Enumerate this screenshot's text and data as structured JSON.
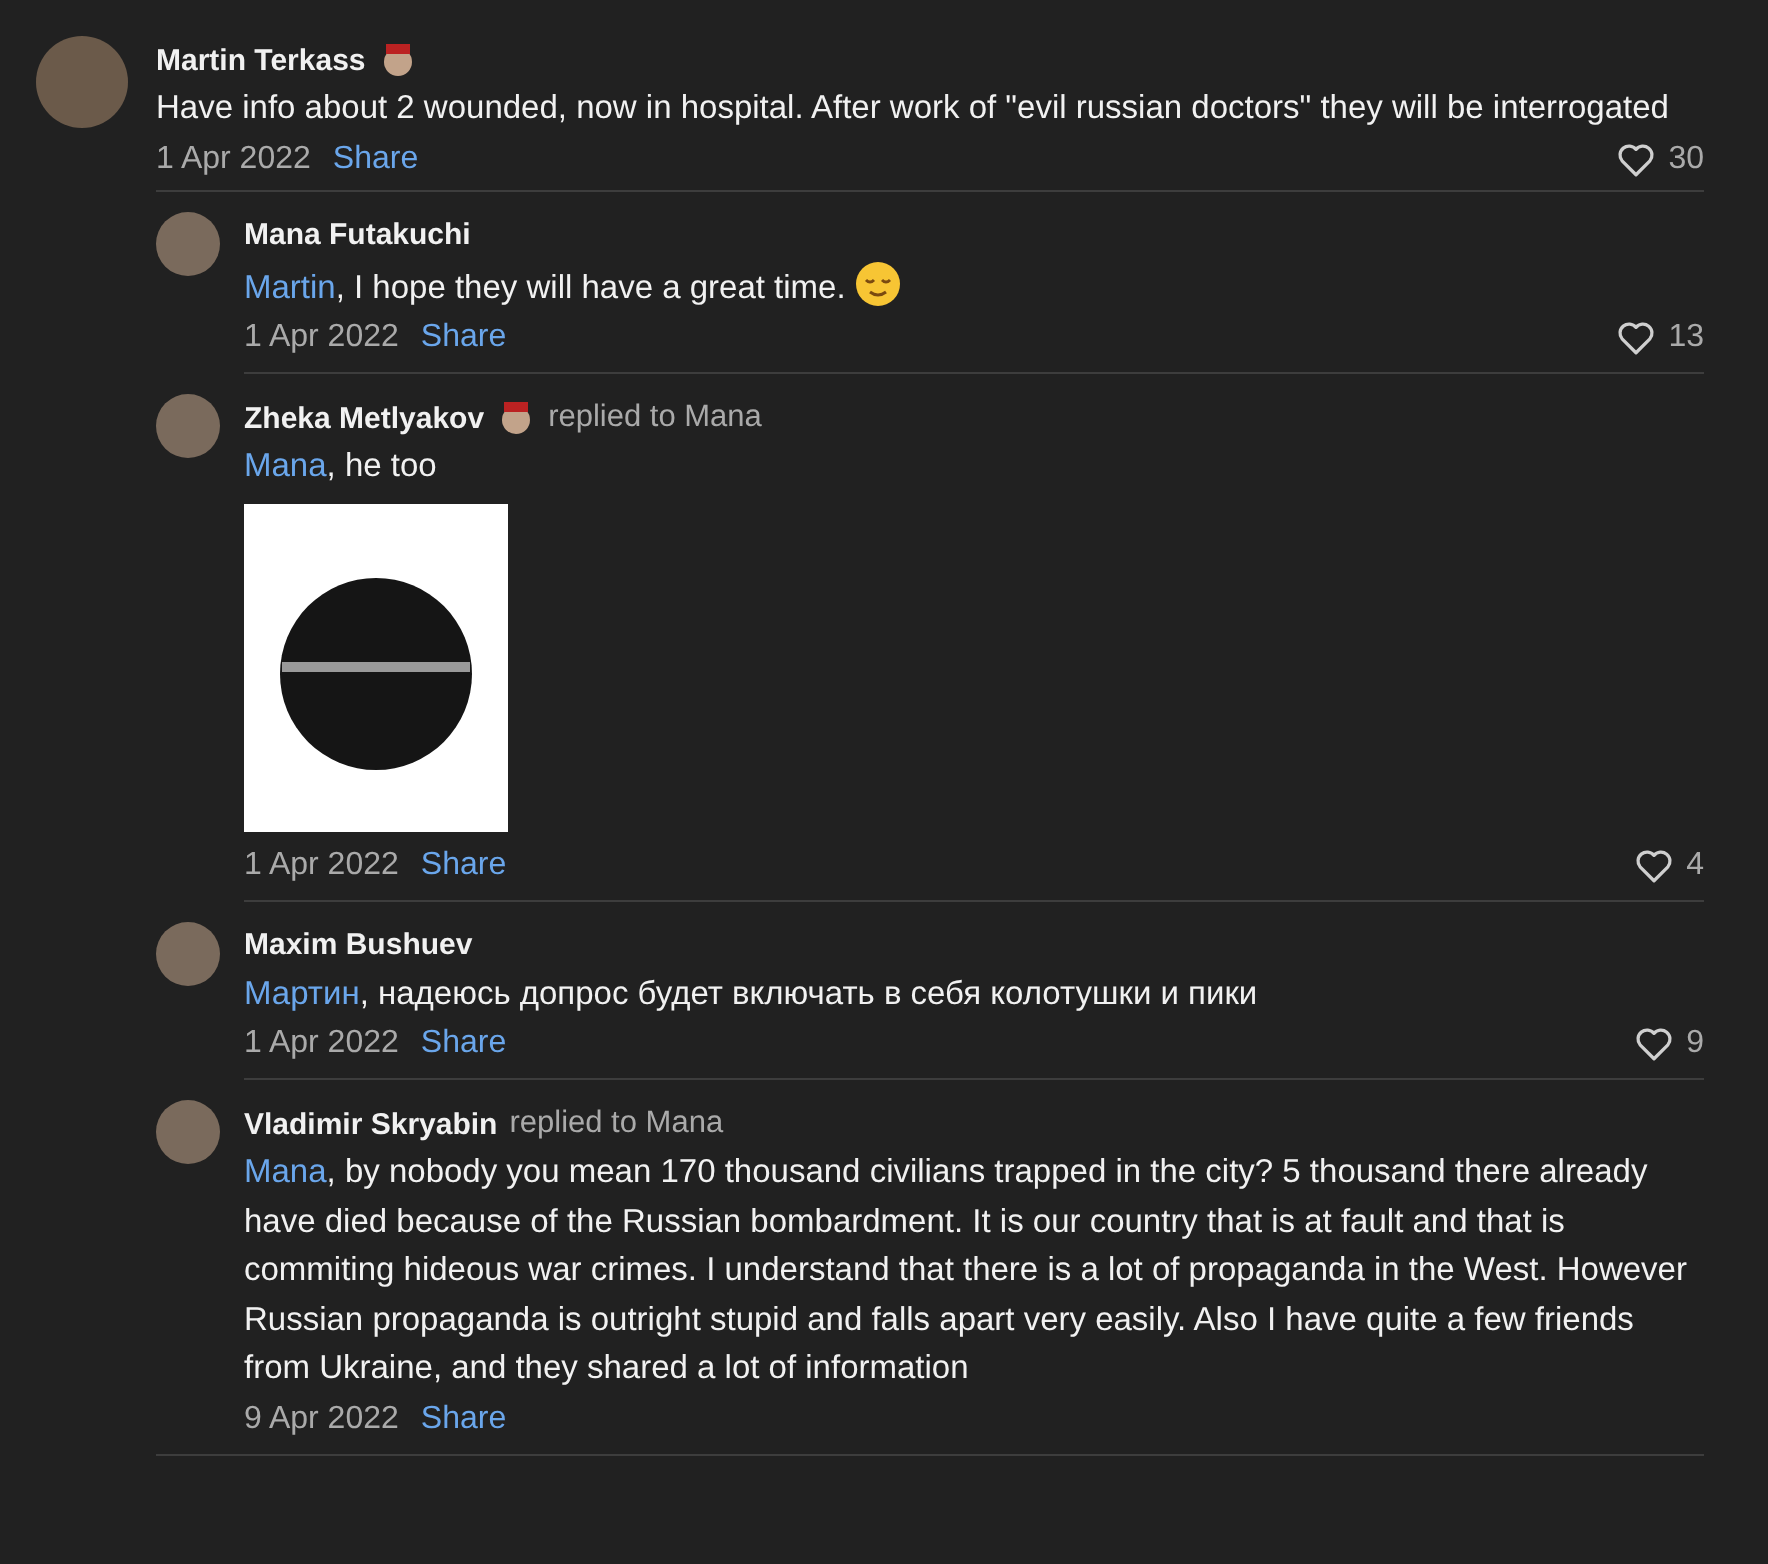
{
  "comment": {
    "author": "Martin Terkass",
    "badge": true,
    "text": "Have info about 2 wounded, now in hospital. After work of \"evil russian doctors\" they will be interrogated",
    "date": "1 Apr 2022",
    "share": "Share",
    "likes": "30"
  },
  "replies": [
    {
      "author": "Mana Futakuchi",
      "mention": "Martin",
      "text": ", I hope they will have a great time.",
      "emoji": true,
      "date": "1 Apr 2022",
      "share": "Share",
      "likes": "13"
    },
    {
      "author": "Zheka Metlyakov",
      "badge": true,
      "replied_to": "replied to Mana",
      "mention": "Mana",
      "text": ", he too",
      "image": true,
      "date": "1 Apr 2022",
      "share": "Share",
      "likes": "4"
    },
    {
      "author": "Maxim Bushuev",
      "mention": "Мартин",
      "text": ", надеюсь допрос будет включать в себя колотушки и пики",
      "date": "1 Apr 2022",
      "share": "Share",
      "likes": "9"
    },
    {
      "author": "Vladimir Skryabin",
      "replied_to": "replied to Mana",
      "mention": "Mana",
      "text": ", by nobody you mean 170 thousand civilians trapped in the city? 5 thousand there already have died because of the Russian bombardment. It is our country that is at fault and that is commiting hideous war crimes. I understand that there is a lot of propaganda in the West. However Russian propaganda is outright stupid and falls apart very easily. Also I have quite a few friends from Ukraine, and they shared a lot of information",
      "date": "9 Apr 2022",
      "share": "Share"
    }
  ]
}
